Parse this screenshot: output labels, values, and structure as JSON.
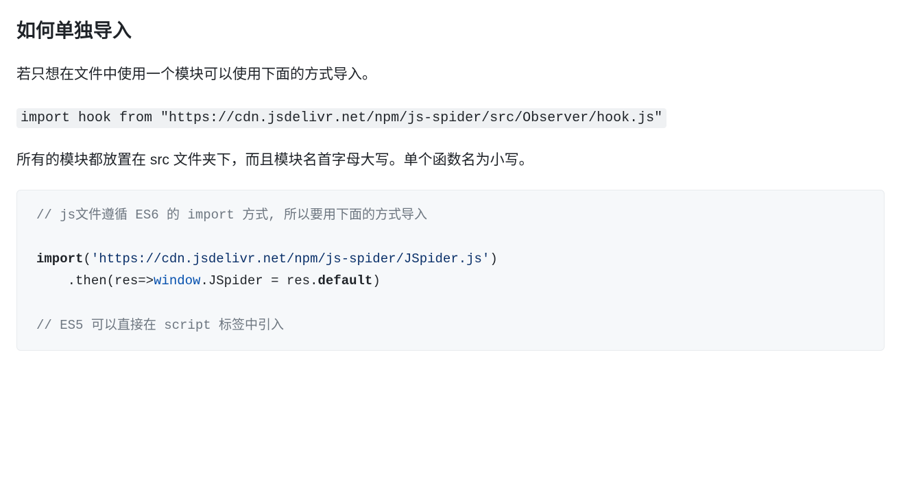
{
  "heading": "如何单独导入",
  "paragraph1_prefix": "若只想在文件中使用一个模块可以使用下面的方式导入。",
  "inline_code": "import hook from \"https://cdn.jsdelivr.net/npm/js-spider/src/Observer/hook.js\"",
  "paragraph2": "所有的模块都放置在 src 文件夹下，而且模块名首字母大写。单个函数名为小写。",
  "code": {
    "comment1": "// js文件遵循 ES6 的 import 方式, 所以要用下面的方式导入",
    "import_kw": "import",
    "open_paren": "(",
    "string_url": "'https://cdn.jsdelivr.net/npm/js-spider/JSpider.js'",
    "close_paren_line1": ")",
    "then_prefix": "    .then(res=>",
    "window_token": "window",
    "then_mid": ".JSpider = res.",
    "default_kw": "default",
    "then_suffix": ")",
    "comment2": "// ES5 可以直接在 script 标签中引入"
  }
}
